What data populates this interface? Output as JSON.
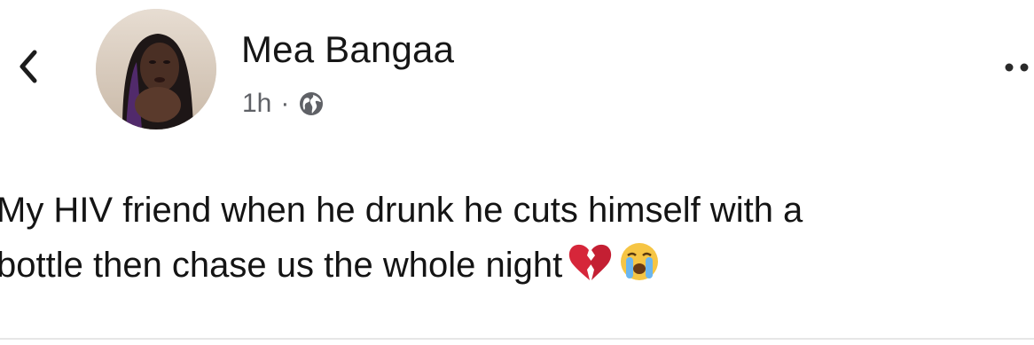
{
  "header": {
    "back_icon": "chevron-left-icon",
    "author_name": "Mea Bangaa",
    "time": "1h",
    "separator": "·",
    "privacy_icon": "globe-icon",
    "more_icon": "more-dots-icon"
  },
  "post": {
    "line1": "My HIV friend when he drunk he cuts himself with a",
    "line2": "bottle then chase us the whole night",
    "emojis": [
      "broken-heart-icon",
      "crying-face-icon"
    ]
  },
  "colors": {
    "text": "#141414",
    "meta": "#5f6166",
    "heart": "#d6263a",
    "emoji_face": "#f6c544",
    "tears": "#6bb6ef"
  }
}
